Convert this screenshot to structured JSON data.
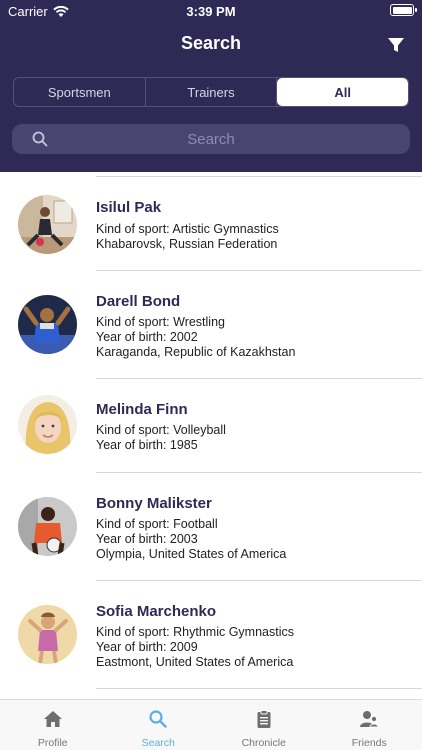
{
  "status_bar": {
    "carrier": "Carrier",
    "time": "3:39 PM"
  },
  "header": {
    "title": "Search"
  },
  "segments": [
    {
      "label": "Sportsmen",
      "active": false
    },
    {
      "label": "Trainers",
      "active": false
    },
    {
      "label": "All",
      "active": true
    }
  ],
  "search": {
    "placeholder": "Search",
    "value": ""
  },
  "people": [
    {
      "name": "Isilul Pak",
      "lines": [
        "Kind of sport: Artistic Gymnastics",
        "Khabarovsk, Russian Federation"
      ]
    },
    {
      "name": "Darell Bond",
      "lines": [
        "Kind of sport: Wrestling",
        "Year of birth: 2002",
        "Karaganda, Republic of Kazakhstan"
      ]
    },
    {
      "name": "Melinda Finn",
      "lines": [
        "Kind of sport: Volleyball",
        "Year of birth: 1985"
      ]
    },
    {
      "name": "Bonny Malikster",
      "lines": [
        "Kind of sport: Football",
        "Year of birth: 2003",
        "Olympia, United States of America"
      ]
    },
    {
      "name": "Sofia Marchenko",
      "lines": [
        "Kind of sport: Rhythmic Gymnastics",
        "Year of birth: 2009",
        "Eastmont, United States of America"
      ]
    }
  ],
  "tabs": [
    {
      "label": "Profile",
      "icon": "home-icon",
      "active": false
    },
    {
      "label": "Search",
      "icon": "search-icon",
      "active": true
    },
    {
      "label": "Chronicle",
      "icon": "clipboard-icon",
      "active": false
    },
    {
      "label": "Friends",
      "icon": "friends-icon",
      "active": false
    }
  ],
  "colors": {
    "header_bg": "#2f2a55",
    "accent": "#5aaee8",
    "name_text": "#2f2a55"
  }
}
